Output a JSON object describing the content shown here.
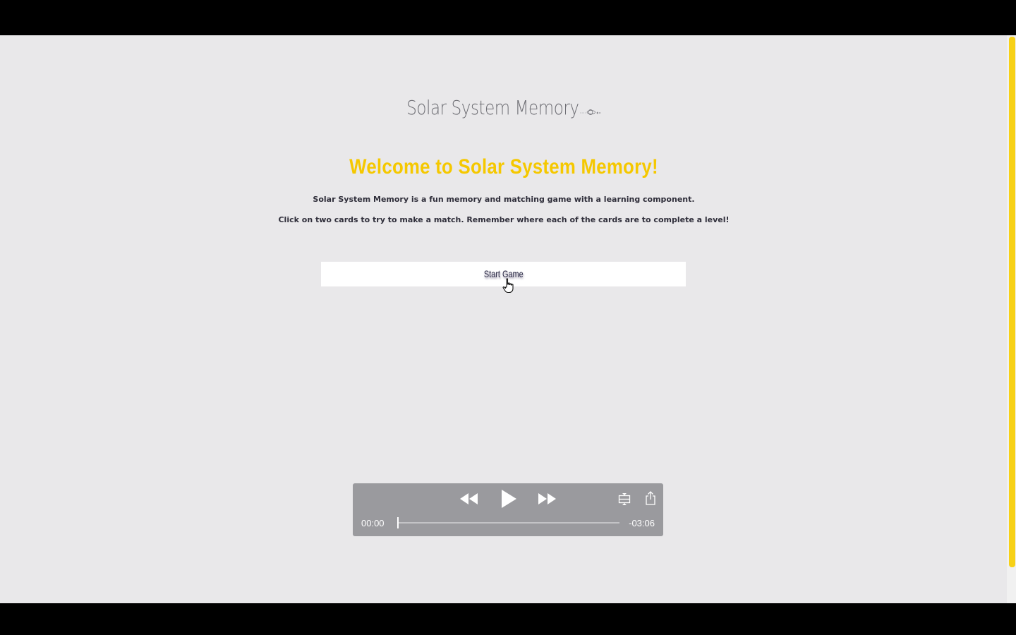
{
  "site": {
    "logo_text": "Solar System Memory"
  },
  "main": {
    "heading": "Welcome to Solar System Memory!",
    "intro_line_1": "Solar System Memory is a fun memory and matching game with a learning component.",
    "intro_line_2": "Click on two cards to try to make a match. Remember where each of the cards are to complete a level!",
    "start_button_label": "Start Game"
  },
  "video_player": {
    "current_time": "00:00",
    "remaining_time": "-03:06",
    "progress": 0.0,
    "controls": [
      "rewind-icon",
      "play-icon",
      "fast-forward-icon",
      "picture-in-picture-icon",
      "share-icon"
    ]
  },
  "colors": {
    "accent_yellow": "#f5c800",
    "page_background": "#e9e8ea",
    "scrollbar_thumb": "#f7d117"
  }
}
